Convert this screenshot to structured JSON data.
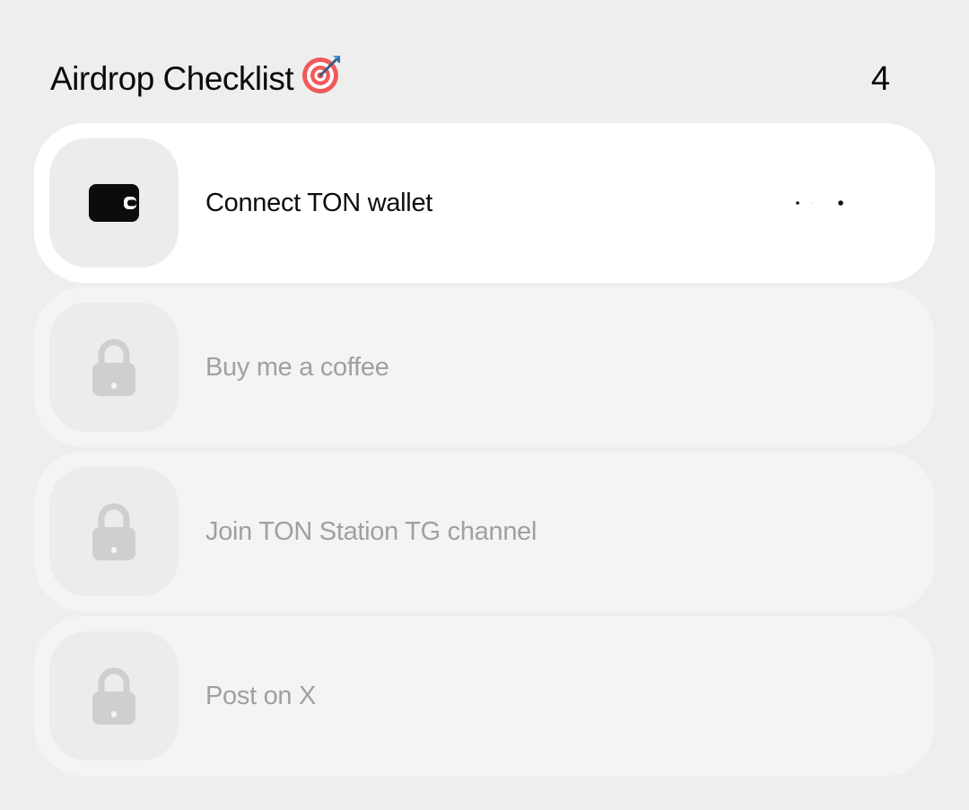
{
  "header": {
    "title": "Airdrop Checklist",
    "title_icon": "target-dart-icon",
    "count": "4"
  },
  "tasks": [
    {
      "label": "Connect TON wallet",
      "icon": "wallet-icon",
      "state": "active"
    },
    {
      "label": "Buy me a coffee",
      "icon": "lock-icon",
      "state": "locked"
    },
    {
      "label": "Join TON Station TG channel",
      "icon": "lock-icon",
      "state": "locked"
    },
    {
      "label": "Post on X",
      "icon": "lock-icon",
      "state": "locked"
    }
  ],
  "colors": {
    "background": "#eeeeee",
    "active_card": "#ffffff",
    "locked_card": "#f4f4f4",
    "locked_text": "#a0a0a0",
    "lock_icon": "#cfcfcf"
  }
}
